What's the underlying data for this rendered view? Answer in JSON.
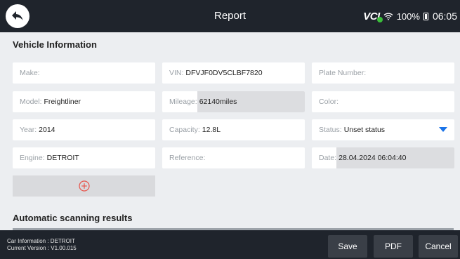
{
  "header": {
    "title": "Report",
    "vci_label": "VCI",
    "wifi_icon": "wifi-icon",
    "battery_percent": "100%",
    "time": "06:05"
  },
  "vehicle_info": {
    "section_title": "Vehicle Information",
    "fields": {
      "make": {
        "label": "Make:",
        "value": ""
      },
      "vin": {
        "label": "VIN:",
        "value": "DFVJF0DV5CLBF7820"
      },
      "plate": {
        "label": "Plate Number:",
        "value": ""
      },
      "model": {
        "label": "Model:",
        "value": "Freightliner"
      },
      "mileage": {
        "label": "Mileage:",
        "value": "62140miles"
      },
      "color": {
        "label": "Color:",
        "value": ""
      },
      "year": {
        "label": "Year:",
        "value": "2014"
      },
      "capacity": {
        "label": "Capacity:",
        "value": "12.8L"
      },
      "status": {
        "label": "Status:",
        "value": "Unset status"
      },
      "engine": {
        "label": "Engine:",
        "value": "DETROIT"
      },
      "reference": {
        "label": "Reference:",
        "value": ""
      },
      "date": {
        "label": "Date:",
        "value": "28.04.2024 06:04:40"
      }
    },
    "add_icon": "plus-circle-icon"
  },
  "scan_results": {
    "section_title": "Automatic scanning results"
  },
  "footer": {
    "car_information": "Car Information : DETROIT",
    "current_version": "Current Version : V1.00.015",
    "save_label": "Save",
    "pdf_label": "PDF",
    "cancel_label": "Cancel"
  },
  "colors": {
    "bar_background": "#1f242c",
    "page_background": "#eceef1",
    "accent_blue": "#1a73e8",
    "add_icon_red": "#e8534a",
    "vci_green": "#3bbf3b"
  }
}
